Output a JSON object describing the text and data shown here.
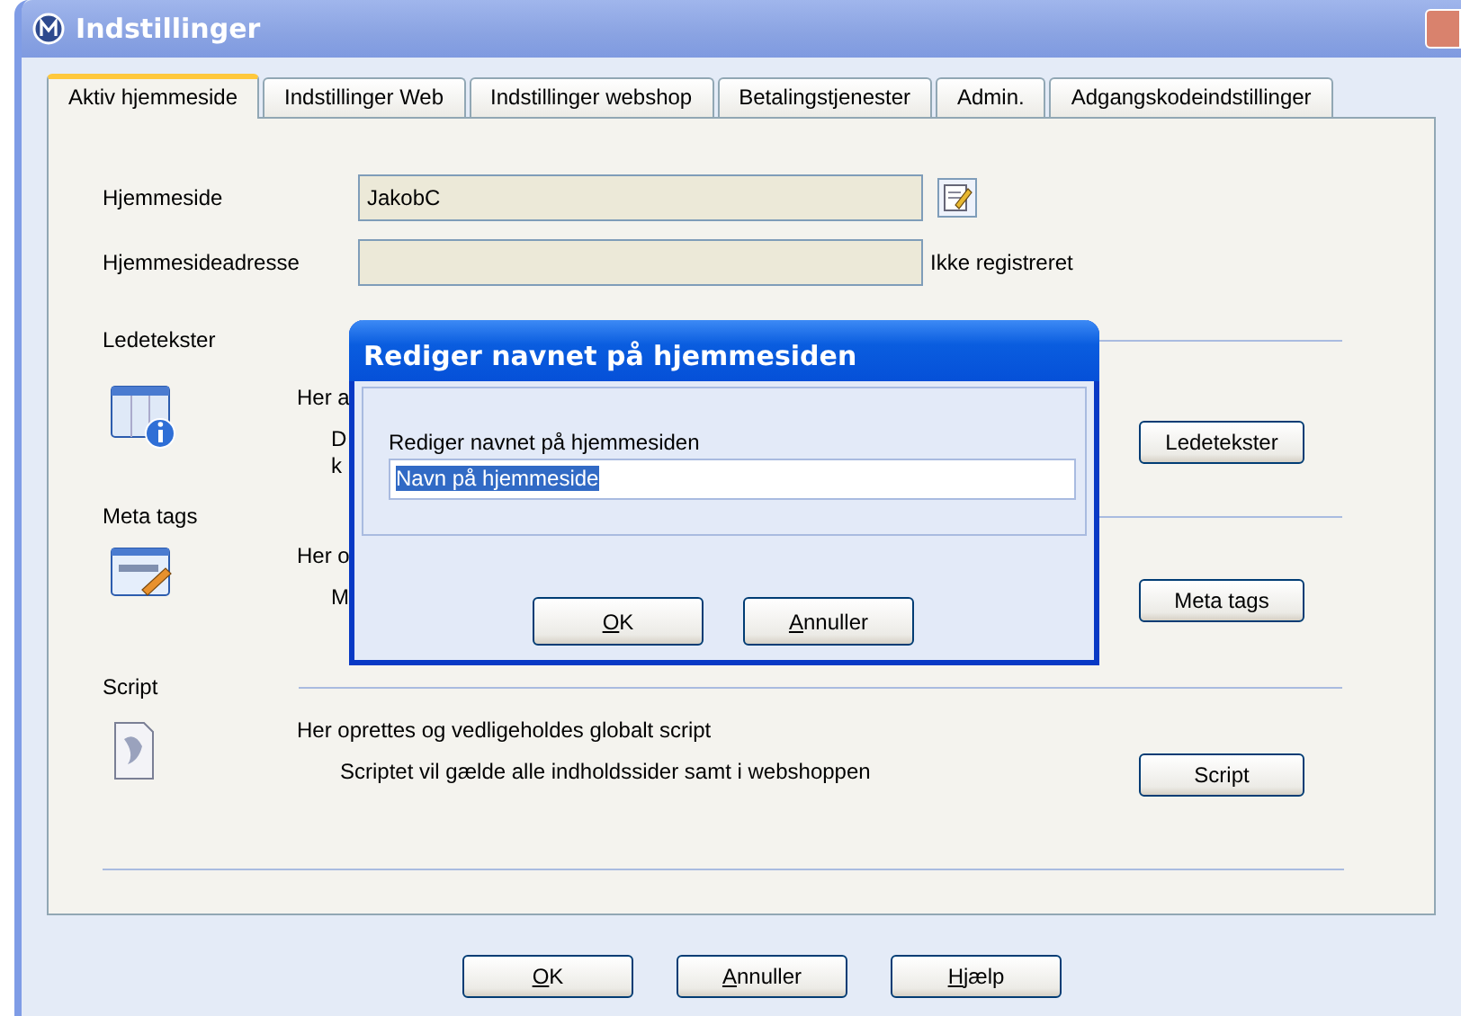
{
  "window": {
    "title": "Indstillinger"
  },
  "tabs": [
    {
      "label": "Aktiv hjemmeside",
      "selected": true
    },
    {
      "label": "Indstillinger Web",
      "selected": false
    },
    {
      "label": "Indstillinger webshop",
      "selected": false
    },
    {
      "label": "Betalingstjenester",
      "selected": false
    },
    {
      "label": "Admin.",
      "selected": false
    },
    {
      "label": "Adgangskodeindstillinger",
      "selected": false
    }
  ],
  "fields": [
    {
      "label": "Hjemmeside",
      "value": "JakobC",
      "kind": "edit"
    },
    {
      "label": "Hjemmesideadresse",
      "note": "Ikke registreret",
      "kind": "note"
    }
  ],
  "sections": [
    {
      "title": "Ledetekster",
      "lines": [
        "Her a",
        "D",
        "k"
      ],
      "button": "Ledetekster"
    },
    {
      "title": "Meta tags",
      "lines": [
        "Her o",
        "M"
      ],
      "button": "Meta tags"
    },
    {
      "title": "Script",
      "lines": [
        "Her oprettes og vedligeholdes globalt script",
        "Scriptet vil gælde alle indholdssider samt i webshoppen"
      ],
      "button": "Script"
    }
  ],
  "buttons": [
    {
      "label": "OK",
      "mnemonic_first": true
    },
    {
      "label": "Annuller",
      "mnemonic_first": true
    },
    {
      "label": "Hjælp",
      "mnemonic_first": true
    }
  ],
  "dialog": {
    "title": "Rediger navnet på hjemmesiden",
    "label": "Rediger navnet på hjemmesiden",
    "value": "Navn på hjemmeside",
    "value_selected": true,
    "buttons": [
      {
        "label": "OK",
        "mnemonic_first": true
      },
      {
        "label": "Annuller",
        "mnemonic_first": true
      }
    ]
  }
}
